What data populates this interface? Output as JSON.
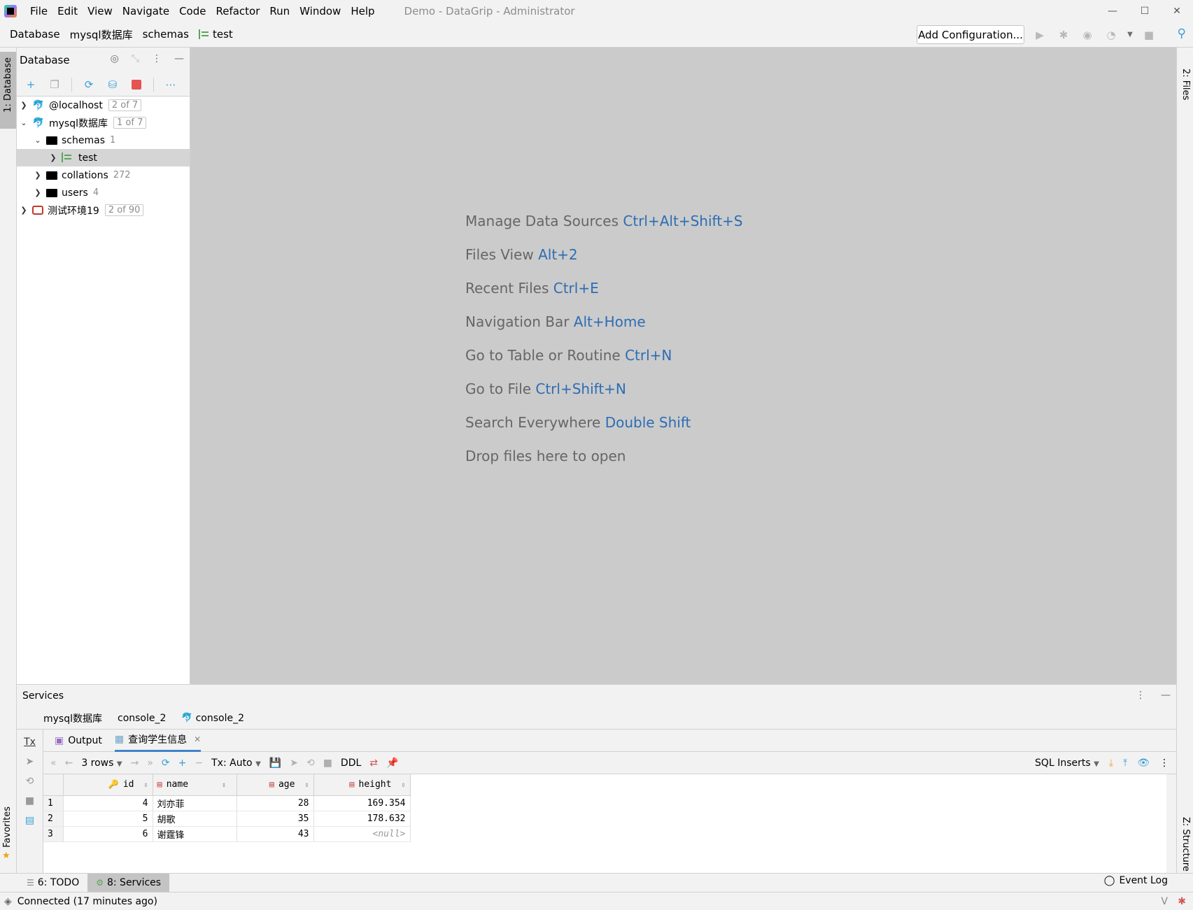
{
  "menu": {
    "items": [
      "File",
      "Edit",
      "View",
      "Navigate",
      "Code",
      "Refactor",
      "Run",
      "Window",
      "Help"
    ],
    "window_title": "Demo - DataGrip - Administrator"
  },
  "window_controls": {
    "minimize": "—",
    "maximize": "☐",
    "close": "✕"
  },
  "navbar": {
    "crumbs": [
      "Database",
      "mysql数据库",
      "schemas",
      "test"
    ],
    "add_configuration": "Add Configuration..."
  },
  "left_stripe": {
    "database_tab": "1: Database",
    "favorites_tab": "Favorites"
  },
  "right_stripe": {
    "files_tab": "2: Files",
    "structure_tab": "Z: Structure"
  },
  "db_panel": {
    "title": "Database",
    "tree": [
      {
        "label": "@localhost",
        "badge": "2 of 7"
      },
      {
        "label": "mysql数据库",
        "badge": "1 of 7"
      },
      {
        "label": "schemas",
        "count": "1"
      },
      {
        "label": "test"
      },
      {
        "label": "collations",
        "count": "272"
      },
      {
        "label": "users",
        "count": "4"
      },
      {
        "label": "测试环境19",
        "badge": "2 of 90"
      }
    ]
  },
  "editor": {
    "tips": [
      {
        "text": "Manage Data Sources",
        "key": "Ctrl+Alt+Shift+S"
      },
      {
        "text": "Files View",
        "key": "Alt+2"
      },
      {
        "text": "Recent Files",
        "key": "Ctrl+E"
      },
      {
        "text": "Navigation Bar",
        "key": "Alt+Home"
      },
      {
        "text": "Go to Table or Routine",
        "key": "Ctrl+N"
      },
      {
        "text": "Go to File",
        "key": "Ctrl+Shift+N"
      },
      {
        "text": "Search Everywhere",
        "key": "Double Shift"
      },
      {
        "text": "Drop files here to open",
        "key": ""
      }
    ]
  },
  "services": {
    "title": "Services",
    "tabs": [
      "mysql数据库",
      "console_2",
      "console_2"
    ],
    "tx_label": "Tx",
    "result_tabs": [
      "Output",
      "查询学生信息"
    ],
    "toolbar": {
      "rows": "3 rows",
      "tx_mode": "Tx: Auto",
      "ddl": "DDL",
      "sql_inserts": "SQL Inserts"
    },
    "grid": {
      "columns": [
        "id",
        "name",
        "age",
        "height"
      ],
      "rows": [
        {
          "n": "1",
          "id": "4",
          "name": "刘亦菲",
          "age": "28",
          "height": "169.354"
        },
        {
          "n": "2",
          "id": "5",
          "name": "胡歌",
          "age": "35",
          "height": "178.632"
        },
        {
          "n": "3",
          "id": "6",
          "name": "谢霆锋",
          "age": "43",
          "height": "<null>"
        }
      ]
    }
  },
  "bottom_tools": {
    "todo": "6: TODO",
    "services": "8: Services",
    "event_log": "Event Log"
  },
  "status": {
    "text": "Connected (17 minutes ago)"
  }
}
